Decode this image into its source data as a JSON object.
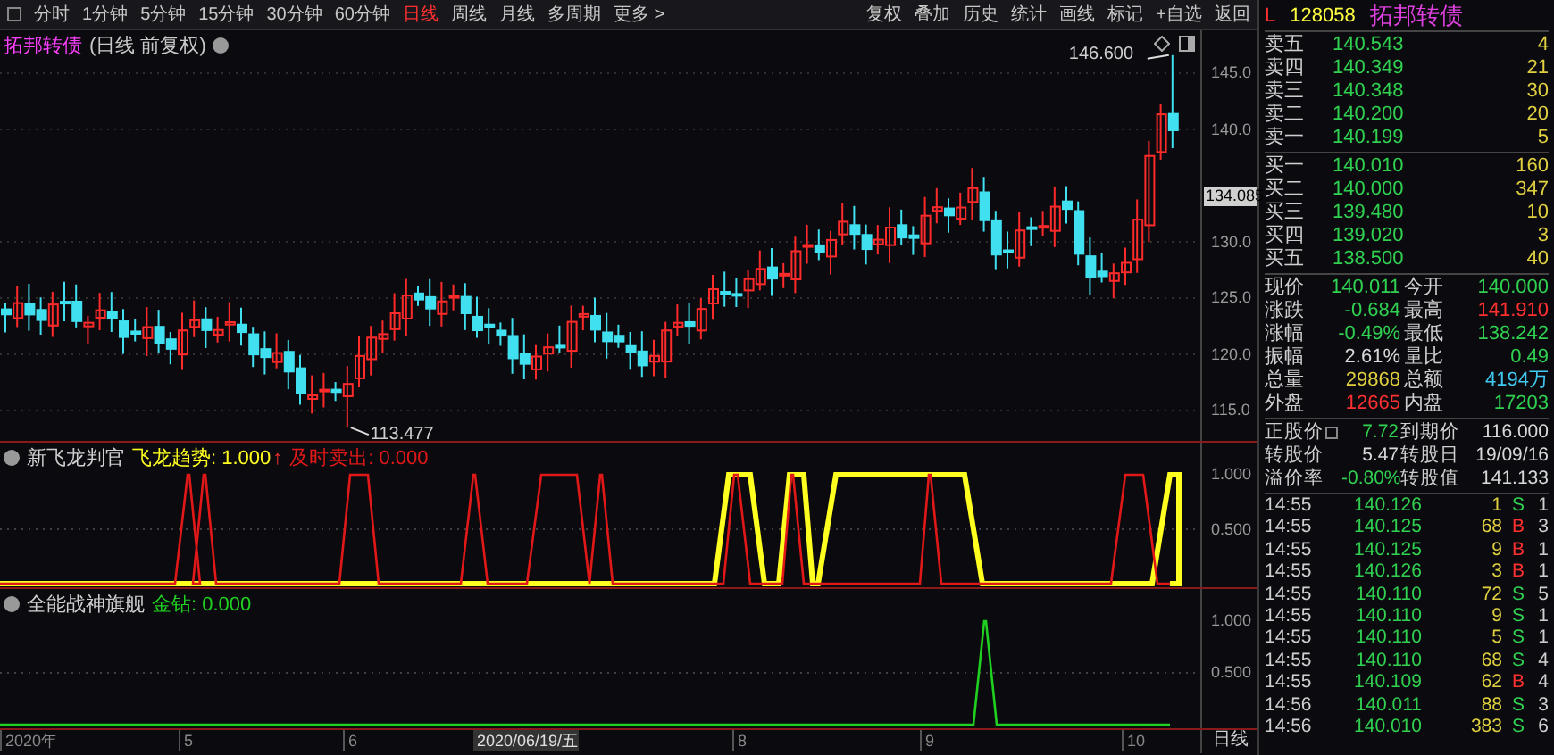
{
  "toolbar": {
    "periods": [
      {
        "label": "分时",
        "selected": false
      },
      {
        "label": "1分钟",
        "selected": false
      },
      {
        "label": "5分钟",
        "selected": false
      },
      {
        "label": "15分钟",
        "selected": false
      },
      {
        "label": "30分钟",
        "selected": false
      },
      {
        "label": "60分钟",
        "selected": false
      },
      {
        "label": "日线",
        "selected": true
      },
      {
        "label": "周线",
        "selected": false
      },
      {
        "label": "月线",
        "selected": false
      },
      {
        "label": "多周期",
        "selected": false
      },
      {
        "label": "更多 >",
        "selected": false
      }
    ],
    "tools": [
      "复权",
      "叠加",
      "历史",
      "统计",
      "画线",
      "标记",
      "+自选",
      "返回"
    ]
  },
  "main_chart": {
    "title": "拓邦转债",
    "subtitle": "(日线 前复权)",
    "y_ticks": [
      "145.0",
      "140.0",
      "130.0",
      "125.0",
      "120.0",
      "115.0"
    ],
    "current_price": "134.085",
    "high_label": "146.600",
    "low_label": "113.477"
  },
  "indicator_1": {
    "name": "新飞龙判官",
    "y_ticks": [
      "1.000",
      "0.500"
    ],
    "series": [
      {
        "label": "飞龙趋势: 1.000",
        "arrow": "↑",
        "color": "#ffff20"
      },
      {
        "label": "及时卖出: 0.000",
        "color": "#e01818"
      }
    ]
  },
  "indicator_2": {
    "name": "全能战神旗舰",
    "y_ticks": [
      "1.000",
      "0.500"
    ],
    "series": [
      {
        "label": "金钻: 0.000",
        "color": "#20d020"
      }
    ]
  },
  "x_axis": {
    "labels": [
      "2020年",
      "5",
      "6",
      "2020/06/19/五",
      "8",
      "9",
      "10"
    ],
    "period": "日线"
  },
  "quote": {
    "market": "L",
    "code": "128058",
    "name": "拓邦转债",
    "asks": [
      {
        "label": "卖五",
        "price": "140.543",
        "volume": "4"
      },
      {
        "label": "卖四",
        "price": "140.349",
        "volume": "21"
      },
      {
        "label": "卖三",
        "price": "140.348",
        "volume": "30"
      },
      {
        "label": "卖二",
        "price": "140.200",
        "volume": "20"
      },
      {
        "label": "卖一",
        "price": "140.199",
        "volume": "5"
      }
    ],
    "bids": [
      {
        "label": "买一",
        "price": "140.010",
        "volume": "160"
      },
      {
        "label": "买二",
        "price": "140.000",
        "volume": "347"
      },
      {
        "label": "买三",
        "price": "139.480",
        "volume": "10"
      },
      {
        "label": "买四",
        "price": "139.020",
        "volume": "3"
      },
      {
        "label": "买五",
        "price": "138.500",
        "volume": "40"
      }
    ],
    "stats": [
      [
        {
          "label": "现价",
          "value": "140.011",
          "color": "#30d050"
        },
        {
          "label": "今开",
          "value": "140.000",
          "color": "#30d050"
        }
      ],
      [
        {
          "label": "涨跌",
          "value": "-0.684",
          "color": "#30d050"
        },
        {
          "label": "最高",
          "value": "141.910",
          "color": "#ff3030"
        }
      ],
      [
        {
          "label": "涨幅",
          "value": "-0.49%",
          "color": "#30d050"
        },
        {
          "label": "最低",
          "value": "138.242",
          "color": "#30d050"
        }
      ],
      [
        {
          "label": "振幅",
          "value": "2.61%",
          "color": "#d8d8d8"
        },
        {
          "label": "量比",
          "value": "0.49",
          "color": "#30d050"
        }
      ],
      [
        {
          "label": "总量",
          "value": "29868",
          "color": "#e0d040"
        },
        {
          "label": "总额",
          "value": "4194万",
          "color": "#40c8f0"
        }
      ],
      [
        {
          "label": "外盘",
          "value": "12665",
          "color": "#ff3030"
        },
        {
          "label": "内盘",
          "value": "17203",
          "color": "#30d050"
        }
      ]
    ],
    "bond": [
      [
        {
          "label": "正股价",
          "value": "7.72",
          "color": "#30d050",
          "icon": true
        },
        {
          "label": "到期价",
          "value": "116.000",
          "color": "#d8d8d8"
        }
      ],
      [
        {
          "label": "转股价",
          "value": "5.47",
          "color": "#d8d8d8"
        },
        {
          "label": "转股日",
          "value": "19/09/16",
          "color": "#d8d8d8"
        }
      ],
      [
        {
          "label": "溢价率",
          "value": "-0.80%",
          "color": "#30d050"
        },
        {
          "label": "转股值",
          "value": "141.133",
          "color": "#d8d8d8"
        }
      ]
    ],
    "trades": [
      {
        "time": "14:55",
        "price": "140.126",
        "volume": "1",
        "side": "S",
        "count": "1"
      },
      {
        "time": "14:55",
        "price": "140.125",
        "volume": "68",
        "side": "B",
        "count": "3"
      },
      {
        "time": "14:55",
        "price": "140.125",
        "volume": "9",
        "side": "B",
        "count": "1"
      },
      {
        "time": "14:55",
        "price": "140.126",
        "volume": "3",
        "side": "B",
        "count": "1"
      },
      {
        "time": "14:55",
        "price": "140.110",
        "volume": "72",
        "side": "S",
        "count": "5"
      },
      {
        "time": "14:55",
        "price": "140.110",
        "volume": "9",
        "side": "S",
        "count": "1"
      },
      {
        "time": "14:55",
        "price": "140.110",
        "volume": "5",
        "side": "S",
        "count": "1"
      },
      {
        "time": "14:55",
        "price": "140.110",
        "volume": "68",
        "side": "S",
        "count": "4"
      },
      {
        "time": "14:55",
        "price": "140.109",
        "volume": "62",
        "side": "B",
        "count": "4"
      },
      {
        "time": "14:56",
        "price": "140.011",
        "volume": "88",
        "side": "S",
        "count": "3"
      },
      {
        "time": "14:56",
        "price": "140.010",
        "volume": "383",
        "side": "S",
        "count": "6"
      }
    ]
  }
}
